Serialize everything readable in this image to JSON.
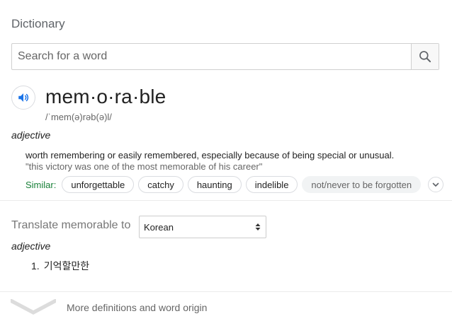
{
  "heading": "Dictionary",
  "search": {
    "placeholder": "Search for a word",
    "value": ""
  },
  "entry": {
    "word": "mem·o·ra·ble",
    "phonetic": "/ˈmem(ə)rəb(ə)l/",
    "part_of_speech": "adjective",
    "definition": "worth remembering or easily remembered, especially because of being special or unusual.",
    "example": "\"this victory was one of the most memorable of his career\"",
    "similar_label": "Similar:",
    "similar": [
      "unforgettable",
      "catchy",
      "haunting",
      "indelible",
      "not/never to be forgotten"
    ]
  },
  "translate": {
    "label": "Translate memorable to",
    "language": "Korean",
    "part_of_speech": "adjective",
    "item_number": "1.",
    "translation": "기억할만한"
  },
  "more": {
    "label": "More definitions and word origin"
  },
  "colors": {
    "accent_blue": "#1a73e8",
    "similar_green": "#188038"
  },
  "icons": [
    "search-icon",
    "speaker-icon",
    "chevron-down-icon",
    "expand-chevron-icon",
    "select-arrows-icon"
  ]
}
